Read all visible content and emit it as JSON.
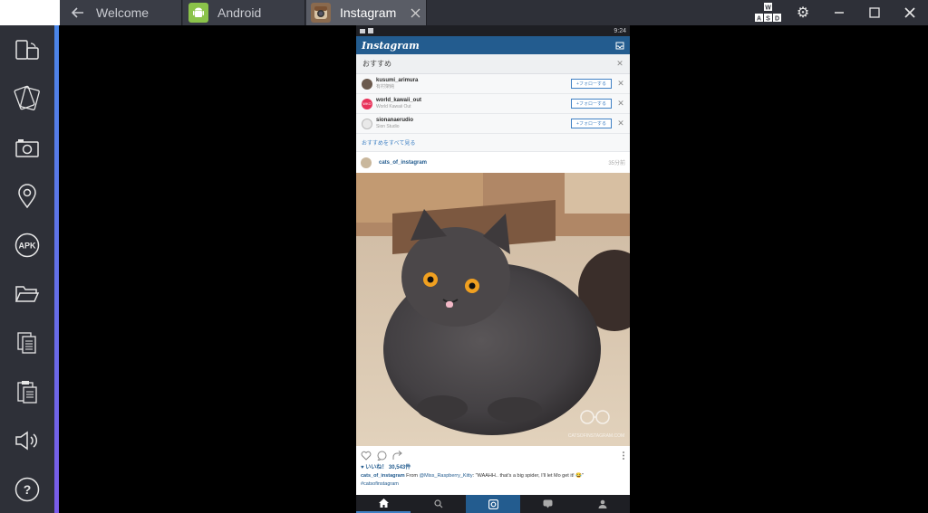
{
  "tabs": [
    {
      "label": "Welcome"
    },
    {
      "label": "Android"
    },
    {
      "label": "Instagram"
    }
  ],
  "toolbar": {
    "wasd_top": "W",
    "wasd_bottom": "A S D"
  },
  "sidebar": {
    "items": [
      {
        "icon": "rotate-device-icon"
      },
      {
        "icon": "shake-icon"
      },
      {
        "icon": "camera-icon"
      },
      {
        "icon": "location-icon"
      },
      {
        "icon": "apk-icon",
        "label": "APK"
      },
      {
        "icon": "folder-icon"
      },
      {
        "icon": "copy-icon"
      },
      {
        "icon": "paste-icon"
      },
      {
        "icon": "volume-icon"
      },
      {
        "icon": "help-icon",
        "label": "?"
      }
    ]
  },
  "phone": {
    "status_time": "9:24",
    "app_title": "Instagram",
    "suggestions": {
      "header": "おすすめ",
      "follow_label": "+フォローする",
      "items": [
        {
          "name": "kusumi_arimura",
          "sub": "有村架純",
          "avatar_color": "#6b5a4e"
        },
        {
          "name": "world_kawaii_out",
          "sub": "World Kawaii Out",
          "avatar_color": "#e8335a",
          "avatar_text": "WKO"
        },
        {
          "name": "sionanaerudio",
          "sub": "Sion Studio",
          "avatar_color": "#e9e9e9"
        }
      ],
      "see_all": "おすすめをすべて見る"
    },
    "post": {
      "username": "cats_of_instagram",
      "time": "35分前",
      "likes": "♥ いいね！ 30,543件",
      "caption_user": "cats_of_instagram",
      "caption_pre": " From ",
      "caption_mention": "@Miss_Raspberry_Kitty",
      "caption_text": ": \"WAAHH.. that's a big spider, I'll let Mo get it! 😂\"",
      "hashtag": "#catsofinstagram",
      "watermark": "CATSOFINSTAGRAM.COM"
    }
  },
  "colors": {
    "ig_blue": "#235c8f",
    "link": "#3f80c4",
    "chrome": "#2e3038"
  }
}
